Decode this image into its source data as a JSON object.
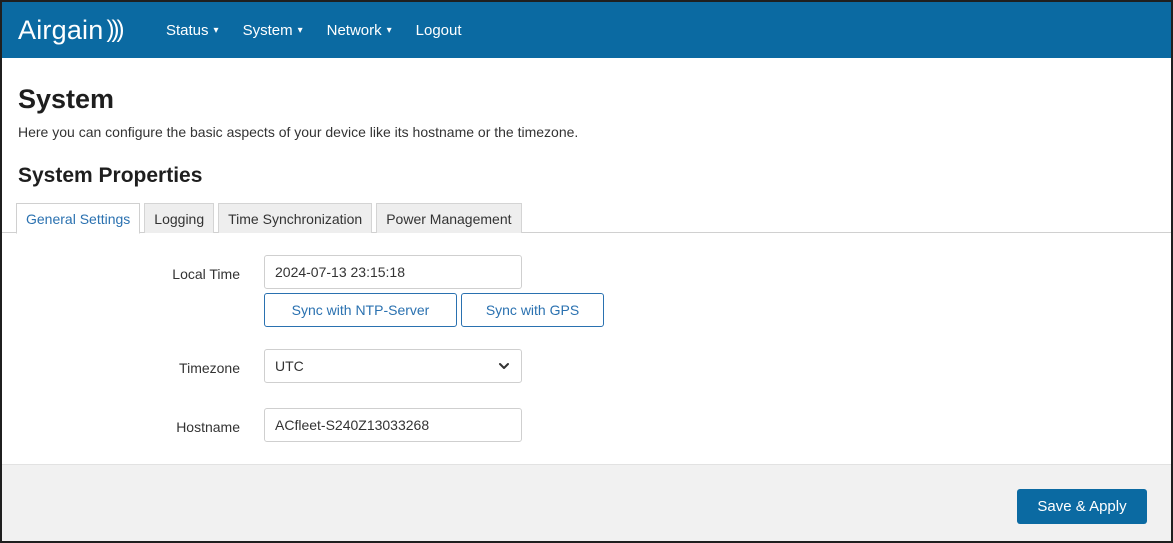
{
  "navbar": {
    "brand": "Airgain",
    "brand_waves": ")))",
    "menu": [
      {
        "label": "Status",
        "dropdown": true
      },
      {
        "label": "System",
        "dropdown": true
      },
      {
        "label": "Network",
        "dropdown": true
      },
      {
        "label": "Logout",
        "dropdown": false
      }
    ],
    "caret_glyph": "▾"
  },
  "page": {
    "title": "System",
    "description": "Here you can configure the basic aspects of your device like its hostname or the timezone.",
    "section_title": "System Properties"
  },
  "tabs": [
    {
      "label": "General Settings",
      "active": true
    },
    {
      "label": "Logging",
      "active": false
    },
    {
      "label": "Time Synchronization",
      "active": false
    },
    {
      "label": "Power Management",
      "active": false
    }
  ],
  "form": {
    "local_time": {
      "label": "Local Time",
      "value": "2024-07-13 23:15:18",
      "sync_ntp_label": "Sync with NTP-Server",
      "sync_gps_label": "Sync with GPS"
    },
    "timezone": {
      "label": "Timezone",
      "value": "UTC"
    },
    "hostname": {
      "label": "Hostname",
      "value": "ACfleet-S240Z13033268"
    }
  },
  "footer": {
    "save_apply_label": "Save & Apply"
  },
  "colors": {
    "navbar": "#0b6aa2",
    "accent": "#2a71b0",
    "footer_bg": "#f1f1f1"
  }
}
